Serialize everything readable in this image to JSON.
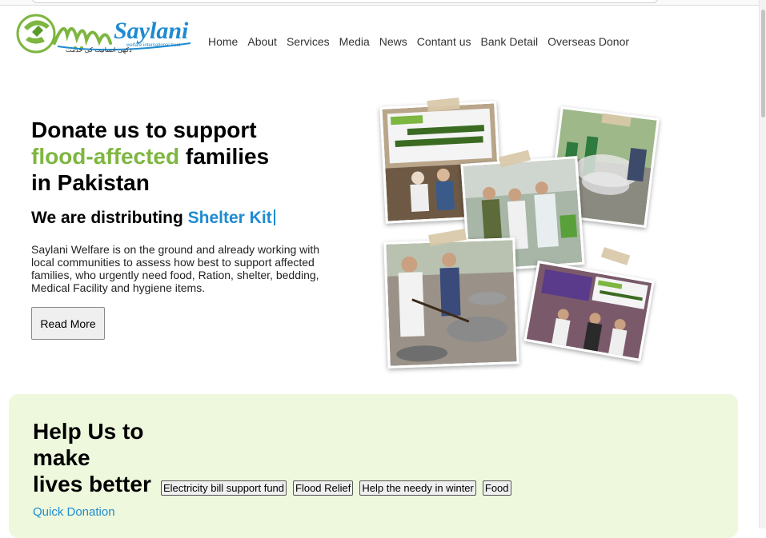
{
  "brand": {
    "name": "Saylani",
    "urdu_name": "سیلانی",
    "tagline": "welfare international trust",
    "urdu_tagline": "دکھی انسانیت کی خدمت"
  },
  "nav": {
    "items": [
      "Home",
      "About",
      "Services",
      "Media",
      "News",
      "Contant us",
      "Bank Detail",
      "Overseas Donor"
    ]
  },
  "hero": {
    "title_line1": "Donate us to support",
    "title_highlight": "flood-affected",
    "title_after_highlight": " families",
    "title_line3": "in Pakistan",
    "subtitle_prefix": "We are distributing ",
    "subtitle_highlight": "Shelter Kit",
    "description": "Saylani Welfare is on the ground and already working with local communities to assess how best to support affected families, who urgently need food, Ration, shelter, bedding, Medical Facility and hygiene items.",
    "read_more_label": "Read More"
  },
  "help": {
    "title_line1": "Help Us to",
    "title_line2": "make",
    "title_line3": "lives better",
    "categories": [
      "Electricity bill support fund",
      "Flood Relief",
      "Help the needy in winter",
      "Food"
    ],
    "quick_donation_label": "Quick Donation"
  },
  "colors": {
    "accent_green": "#7db640",
    "accent_blue": "#1e8bd1",
    "help_background": "#eef8dd"
  }
}
